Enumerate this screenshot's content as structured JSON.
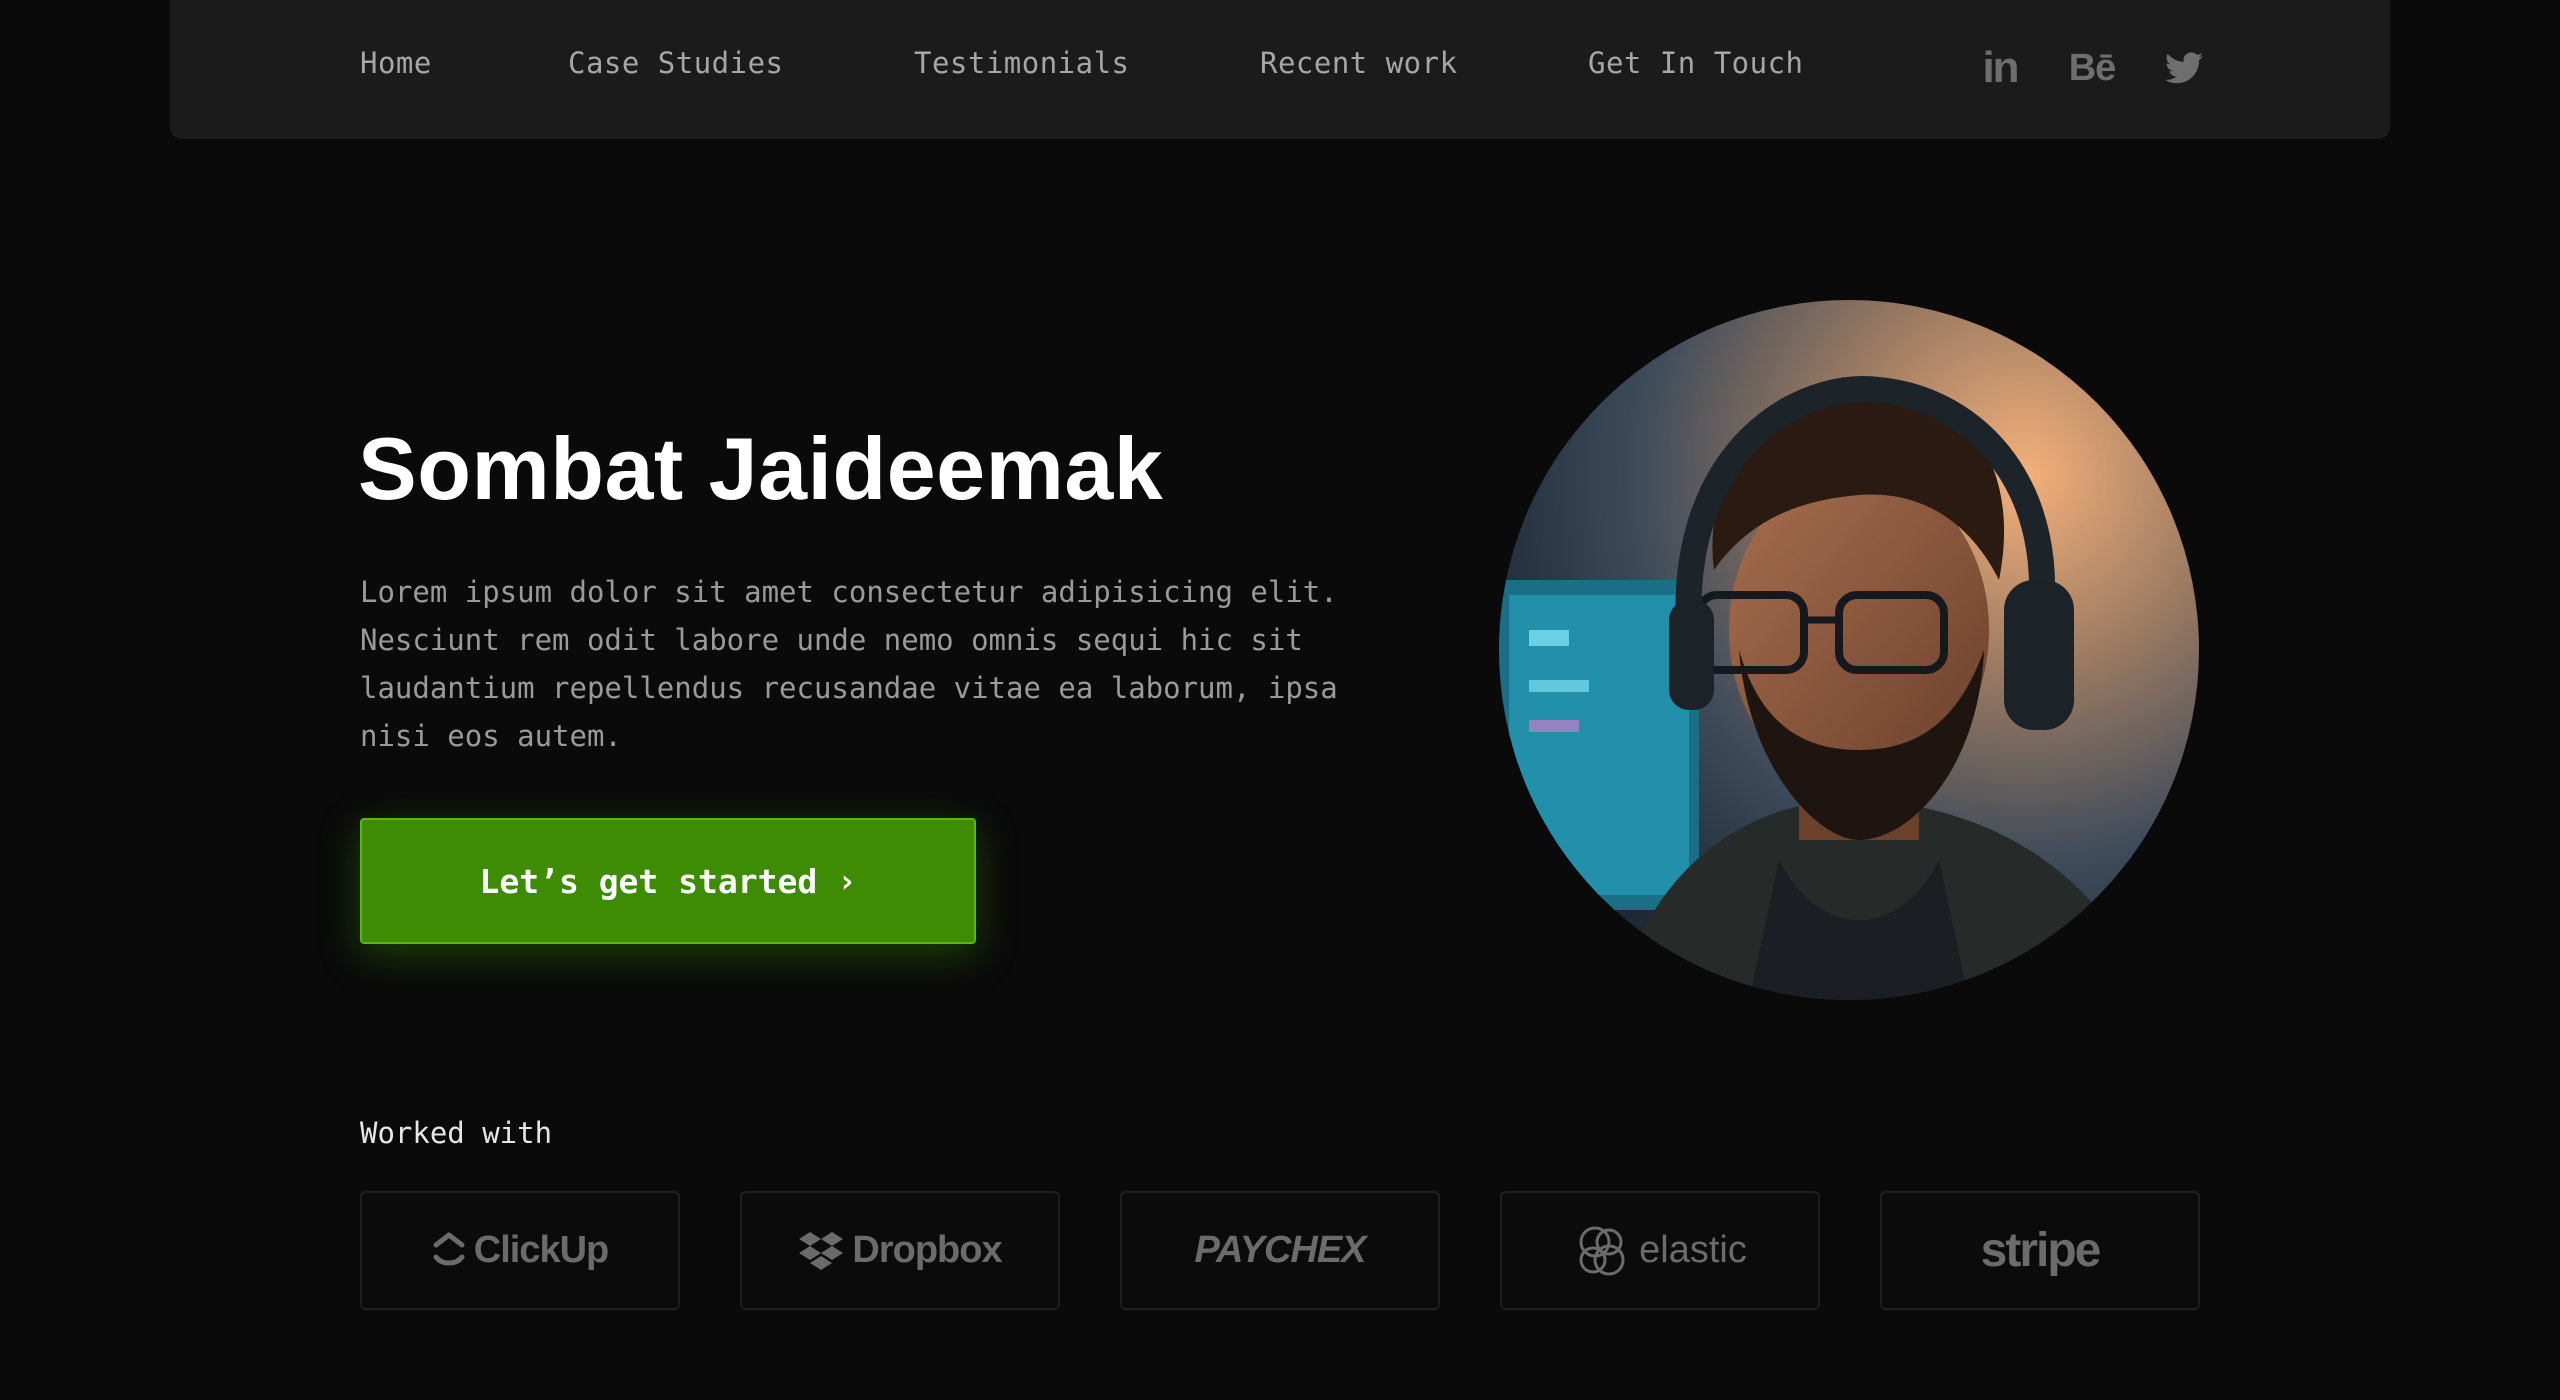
{
  "nav": {
    "links": [
      "Home",
      "Case Studies",
      "Testimonials",
      "Recent work",
      "Get In Touch"
    ],
    "social": {
      "linkedin": "in",
      "behance": "Bē"
    }
  },
  "hero": {
    "title": "Sombat Jaideemak",
    "description": "Lorem ipsum dolor sit amet consectetur adipisicing elit. Nesciunt rem odit labore unde nemo omnis sequi hic sit laudantium repellendus recusandae vitae ea laborum, ipsa nisi eos autem.",
    "cta_label": "Let’s get started",
    "cta_chevron": "›"
  },
  "worked_with": {
    "label": "Worked with",
    "logos": [
      "ClickUp",
      "Dropbox",
      "PAYCHEX",
      "elastic",
      "stripe"
    ]
  },
  "colors": {
    "background": "#0a0a0a",
    "nav_bg": "#1b1b1b",
    "accent_green": "#3d8c04",
    "muted_text": "#9a9a9a"
  }
}
